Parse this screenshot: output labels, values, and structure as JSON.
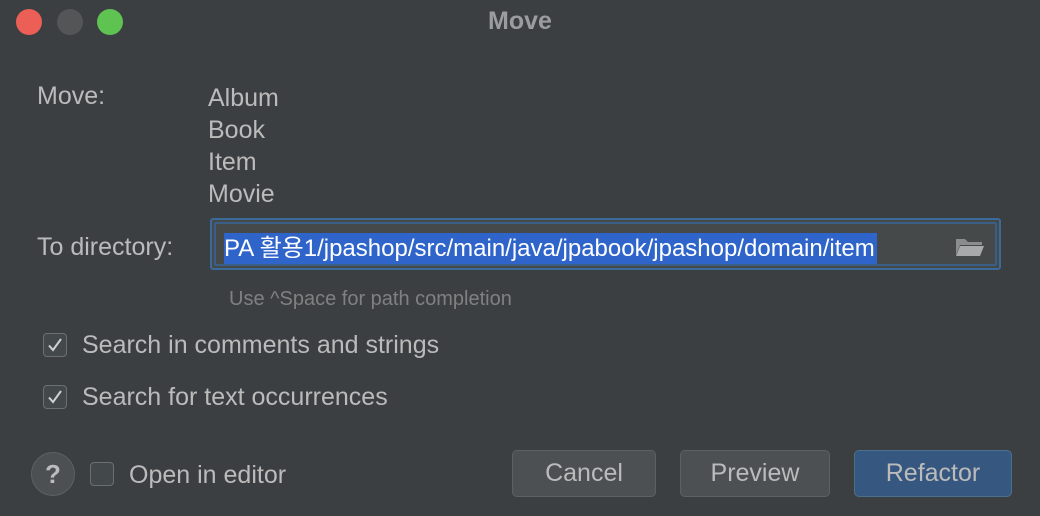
{
  "window": {
    "title": "Move"
  },
  "move": {
    "label": "Move:",
    "items": [
      "Album",
      "Book",
      "Item",
      "Movie"
    ]
  },
  "directory": {
    "label": "To directory:",
    "value": "PA 활용1/jpashop/src/main/java/jpabook/jpashop/domain/item",
    "hint": "Use ^Space for path completion"
  },
  "options": {
    "search_comments": {
      "label": "Search in comments and strings",
      "checked": true
    },
    "search_text": {
      "label": "Search for text occurrences",
      "checked": true
    },
    "open_editor": {
      "label": "Open in editor",
      "checked": false
    }
  },
  "buttons": {
    "help": "?",
    "cancel": "Cancel",
    "preview": "Preview",
    "refactor": "Refactor"
  },
  "colors": {
    "background": "#3c3f41",
    "accent": "#365880",
    "selection": "#2f65ca",
    "close": "#ec5f56",
    "maximize": "#5fc351"
  }
}
